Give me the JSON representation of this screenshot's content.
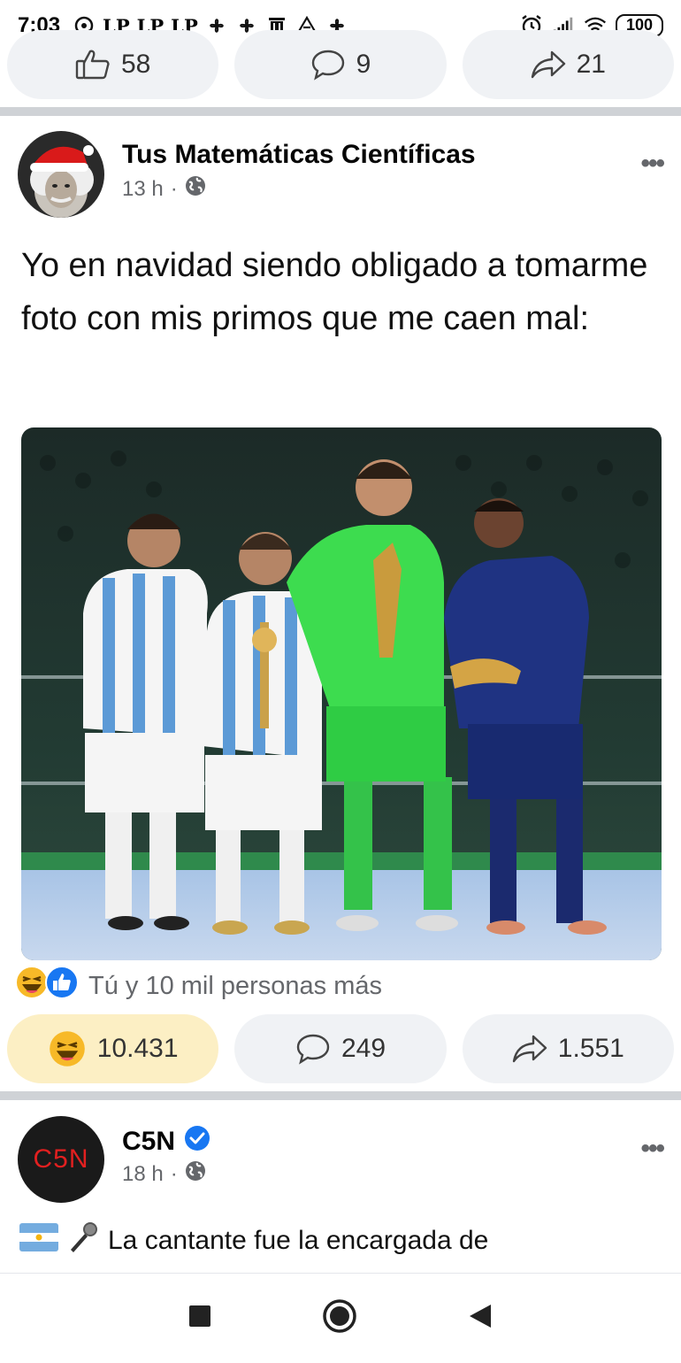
{
  "status_bar": {
    "time": "7:03",
    "lp_indicators": [
      "LP",
      "LP",
      "LP"
    ],
    "battery": "100",
    "icons": [
      "notification-icon",
      "pinwheel-icon",
      "trash-icon",
      "drive-icon",
      "alarm-icon",
      "signal-icon",
      "wifi-icon",
      "battery-icon"
    ]
  },
  "prev_post": {
    "likes": "58",
    "comments": "9",
    "shares": "21"
  },
  "post1": {
    "author": "Tus Matemáticas Científicas",
    "time": "13 h",
    "dot": "·",
    "more": "•••",
    "text": "Yo en navidad siendo obligado a tomarme foto con mis primos que me caen mal:",
    "reaction_summary": "Tú y 10 mil personas más",
    "reactions_count": "10.431",
    "comments_count": "249",
    "shares_count": "1.551"
  },
  "post2": {
    "author": "C5N",
    "avatar_text": "C5N",
    "time": "18 h",
    "dot": "·",
    "more": "•••",
    "text": "La cantante fue la encargada de"
  },
  "colors": {
    "pill_bg": "#f0f2f5",
    "reacted_bg": "#fcefc4",
    "verified_blue": "#1877f2",
    "meta_gray": "#65676b"
  }
}
